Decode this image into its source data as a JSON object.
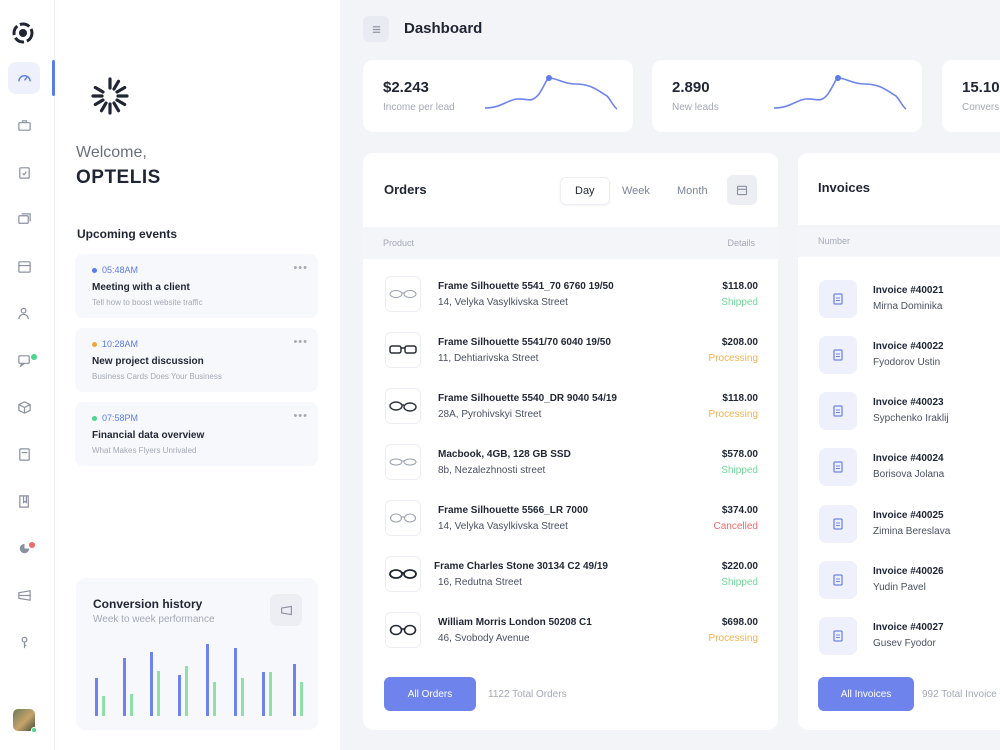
{
  "header": {
    "title": "Dashboard"
  },
  "panel": {
    "welcome": "Welcome,",
    "org_name": "OPTELIS",
    "events_title": "Upcoming events",
    "events": [
      {
        "time": "05:48AM",
        "title": "Meeting with a client",
        "subtitle": "Tell how to boost website traffic",
        "color": "#5b7be8"
      },
      {
        "time": "10:28AM",
        "title": "New project discussion",
        "subtitle": "Business Cards Does Your Business",
        "color": "#f0a63c"
      },
      {
        "time": "07:58PM",
        "title": "Financial data overview",
        "subtitle": "What Makes Flyers Unrivaled",
        "color": "#4cd68a"
      }
    ],
    "conversion": {
      "title": "Conversion history",
      "subtitle": "Week to week performance"
    }
  },
  "kpis": [
    {
      "value": "$2.243",
      "label": "Income per lead"
    },
    {
      "value": "2.890",
      "label": "New leads"
    },
    {
      "value": "15.10",
      "label": "Convers"
    }
  ],
  "orders": {
    "title": "Orders",
    "ranges": [
      "Day",
      "Week",
      "Month"
    ],
    "active_range": "Day",
    "col_product": "Product",
    "col_details": "Details",
    "rows": [
      {
        "name": "Frame Silhouette 5541_70 6760 19/50",
        "address": "14, Velyka Vasylkivska Street",
        "price": "$118.00",
        "status": "Shipped"
      },
      {
        "name": "Frame Silhouette 5541/70 6040 19/50",
        "address": "11, Dehtiarivska Street",
        "price": "$208.00",
        "status": "Processing"
      },
      {
        "name": "Frame Silhouette 5540_DR 9040 54/19",
        "address": "28A, Pyrohivskyi Street",
        "price": "$118.00",
        "status": "Processing"
      },
      {
        "name": "Macbook, 4GB, 128 GB SSD",
        "address": "8b, Nezalezhnosti street",
        "price": "$578.00",
        "status": "Shipped"
      },
      {
        "name": "Frame Silhouette 5566_LR 7000",
        "address": "14, Velyka Vasylkivska Street",
        "price": "$374.00",
        "status": "Cancelled"
      },
      {
        "name": "Frame Charles Stone 30134 C2 49/19",
        "address": "16, Redutna Street",
        "price": "$220.00",
        "status": "Shipped"
      },
      {
        "name": "William Morris London 50208 C1",
        "address": "46, Svobody Avenue",
        "price": "$698.00",
        "status": "Processing"
      }
    ],
    "button": "All Orders",
    "total": "1122 Total Orders"
  },
  "invoices": {
    "title": "Invoices",
    "col_number": "Number",
    "rows": [
      {
        "number": "Invoice #40021",
        "name": "Mirna Dominika"
      },
      {
        "number": "Invoice #40022",
        "name": "Fyodorov Ustin"
      },
      {
        "number": "Invoice #40023",
        "name": "Sypchenko Iraklij"
      },
      {
        "number": "Invoice #40024",
        "name": "Borisova Jolana"
      },
      {
        "number": "Invoice #40025",
        "name": "Zimina Bereslava"
      },
      {
        "number": "Invoice #40026",
        "name": "Yudin Pavel"
      },
      {
        "number": "Invoice #40027",
        "name": "Gusev Fyodor"
      }
    ],
    "button": "All Invoices",
    "total": "992 Total Invoice"
  },
  "colors": {
    "accent": "#5b7be8",
    "button": "#6e84ec",
    "shipped": "#6fd69a",
    "processing": "#f0b24c",
    "cancelled": "#ef6b6b",
    "bar_blue": "#6e84ec",
    "bar_green": "#8ee0a8"
  },
  "icons": {
    "rail": [
      "dashboard-icon",
      "briefcase-icon",
      "clipboard-check-icon",
      "layers-icon",
      "calendar-icon",
      "users-icon",
      "chat-icon",
      "box-icon",
      "document-icon",
      "book-icon",
      "pie-chart-icon",
      "ticket-icon",
      "key-icon"
    ]
  }
}
